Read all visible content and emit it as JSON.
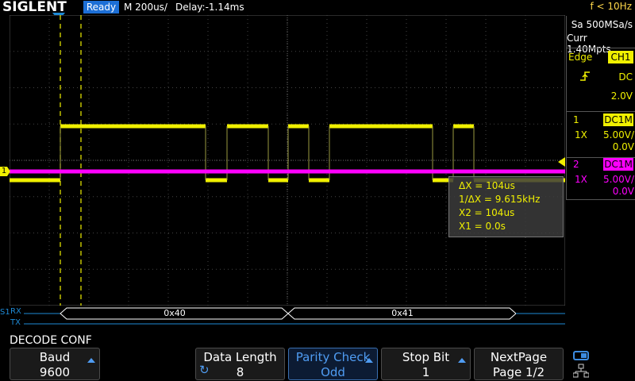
{
  "header": {
    "brand": "SIGLENT",
    "status": "Ready",
    "timebase": "M 200us/",
    "delay": "Delay:-1.14ms",
    "frequency": "f < 10Hz"
  },
  "acquisition": {
    "sample_rate": "Sa 500MSa/s",
    "memory_depth": "Curr 1.40Mpts"
  },
  "trigger": {
    "type": "Edge",
    "source": "CH1",
    "slope_icon": "rising-edge-icon",
    "coupling": "DC",
    "level": "2.0V"
  },
  "channels": [
    {
      "number": "1",
      "coupling": "DC1M",
      "probe": "1X",
      "scale": "5.00V/",
      "offset": "0.0V",
      "color": "#f0f000"
    },
    {
      "number": "2",
      "coupling": "DC1M",
      "probe": "1X",
      "scale": "5.00V/",
      "offset": "0.0V",
      "color": "#ff00ff"
    }
  ],
  "cursors": {
    "delta_x": "ΔX = 104us",
    "inv_delta_x": "1/ΔX = 9.615kHz",
    "x2": "X2 = 104us",
    "x1": "X1 = 0.0s"
  },
  "markers": {
    "ch1_marker": "1",
    "decode_marker": "S1"
  },
  "decode": {
    "rx_label": "RX",
    "tx_label": "TX",
    "rx_packets": [
      "0x40",
      "0x41"
    ],
    "title": "DECODE CONF"
  },
  "softkeys": {
    "baud_label": "Baud",
    "baud_value": "9600",
    "data_length_label": "Data Length",
    "data_length_value": "8",
    "parity_label": "Parity Check",
    "parity_value": "Odd",
    "stop_bit_label": "Stop Bit",
    "stop_bit_value": "1",
    "next_page_label": "NextPage",
    "next_page_value": "Page 1/2"
  },
  "colors": {
    "ch1": "#f0f000",
    "ch2": "#ff00ff",
    "accent": "#1d6fd6",
    "decode": "#1e8ad6"
  }
}
